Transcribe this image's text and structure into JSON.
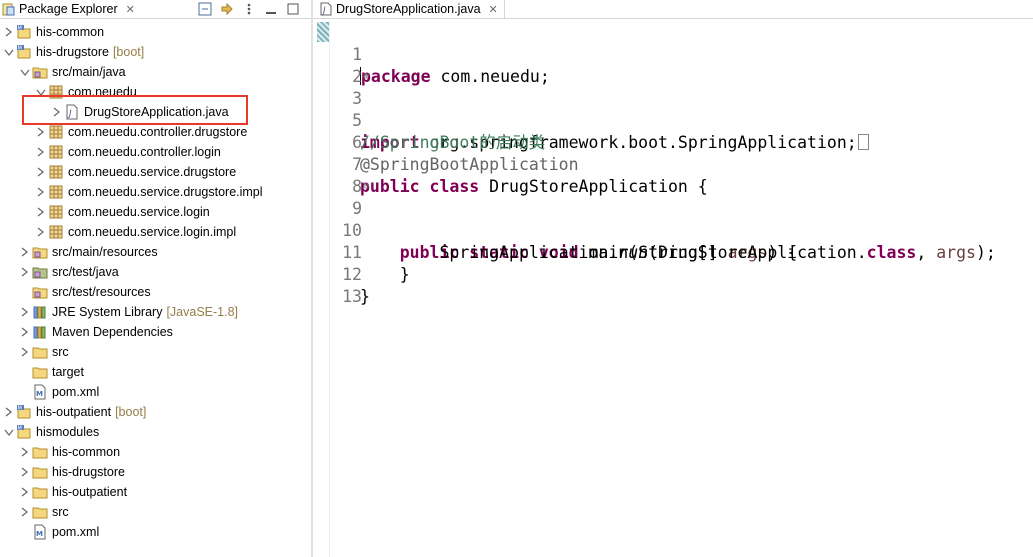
{
  "explorer": {
    "title": "Package Explorer",
    "close_glyph": "✕",
    "items": [
      {
        "label": "his-common",
        "decoration": ""
      },
      {
        "label": "his-drugstore",
        "decoration": "[boot]"
      },
      {
        "label": "src/main/java",
        "decoration": ""
      },
      {
        "label": "com.neuedu",
        "decoration": ""
      },
      {
        "label": "DrugStoreApplication.java",
        "decoration": ""
      },
      {
        "label": "com.neuedu.controller.drugstore",
        "decoration": ""
      },
      {
        "label": "com.neuedu.controller.login",
        "decoration": ""
      },
      {
        "label": "com.neuedu.service.drugstore",
        "decoration": ""
      },
      {
        "label": "com.neuedu.service.drugstore.impl",
        "decoration": ""
      },
      {
        "label": "com.neuedu.service.login",
        "decoration": ""
      },
      {
        "label": "com.neuedu.service.login.impl",
        "decoration": ""
      },
      {
        "label": "src/main/resources",
        "decoration": ""
      },
      {
        "label": "src/test/java",
        "decoration": ""
      },
      {
        "label": "src/test/resources",
        "decoration": ""
      },
      {
        "label": "JRE System Library",
        "decoration": "[JavaSE-1.8]"
      },
      {
        "label": "Maven Dependencies",
        "decoration": ""
      },
      {
        "label": "src",
        "decoration": ""
      },
      {
        "label": "target",
        "decoration": ""
      },
      {
        "label": "pom.xml",
        "decoration": ""
      },
      {
        "label": "his-outpatient",
        "decoration": "[boot]"
      },
      {
        "label": "hismodules",
        "decoration": ""
      },
      {
        "label": "his-common",
        "decoration": ""
      },
      {
        "label": "his-drugstore",
        "decoration": ""
      },
      {
        "label": "his-outpatient",
        "decoration": ""
      },
      {
        "label": "src",
        "decoration": ""
      },
      {
        "label": "pom.xml",
        "decoration": ""
      }
    ]
  },
  "editor": {
    "tab_title": "DrugStoreApplication.java",
    "close_glyph": "✕",
    "line_numbers": [
      "1",
      "2",
      "3",
      "5",
      "6",
      "7",
      "8",
      "9",
      "10",
      "11",
      "12",
      "13"
    ],
    "code": {
      "l1_kw": "package",
      "l1_rest": " com.neuedu;",
      "l3_kw": "import",
      "l3_rest": " org.springframework.boot.SpringApplication;",
      "l5_comment": "//SpringBoot的启动类",
      "l6_annotation": "@SpringBootApplication",
      "l7_kw": "public class",
      "l7_rest": " DrugStoreApplication {",
      "l9_kw": "public static void",
      "l9_rest1": " main(String[] ",
      "l9_var": "args",
      "l9_rest2": ") {",
      "l10_a": "SpringApplication.",
      "l10_method": "run",
      "l10_b": "(DrugStoreApplication.",
      "l10_kw": "class",
      "l10_c": ", ",
      "l10_var": "args",
      "l10_d": ");",
      "l11": "}",
      "l12": "}"
    }
  },
  "colors": {
    "keyword": "#7f0055",
    "comment": "#3f7f5f",
    "annotation": "#646464",
    "decoration": "#957d47",
    "selection_highlight": "#e8392c"
  }
}
